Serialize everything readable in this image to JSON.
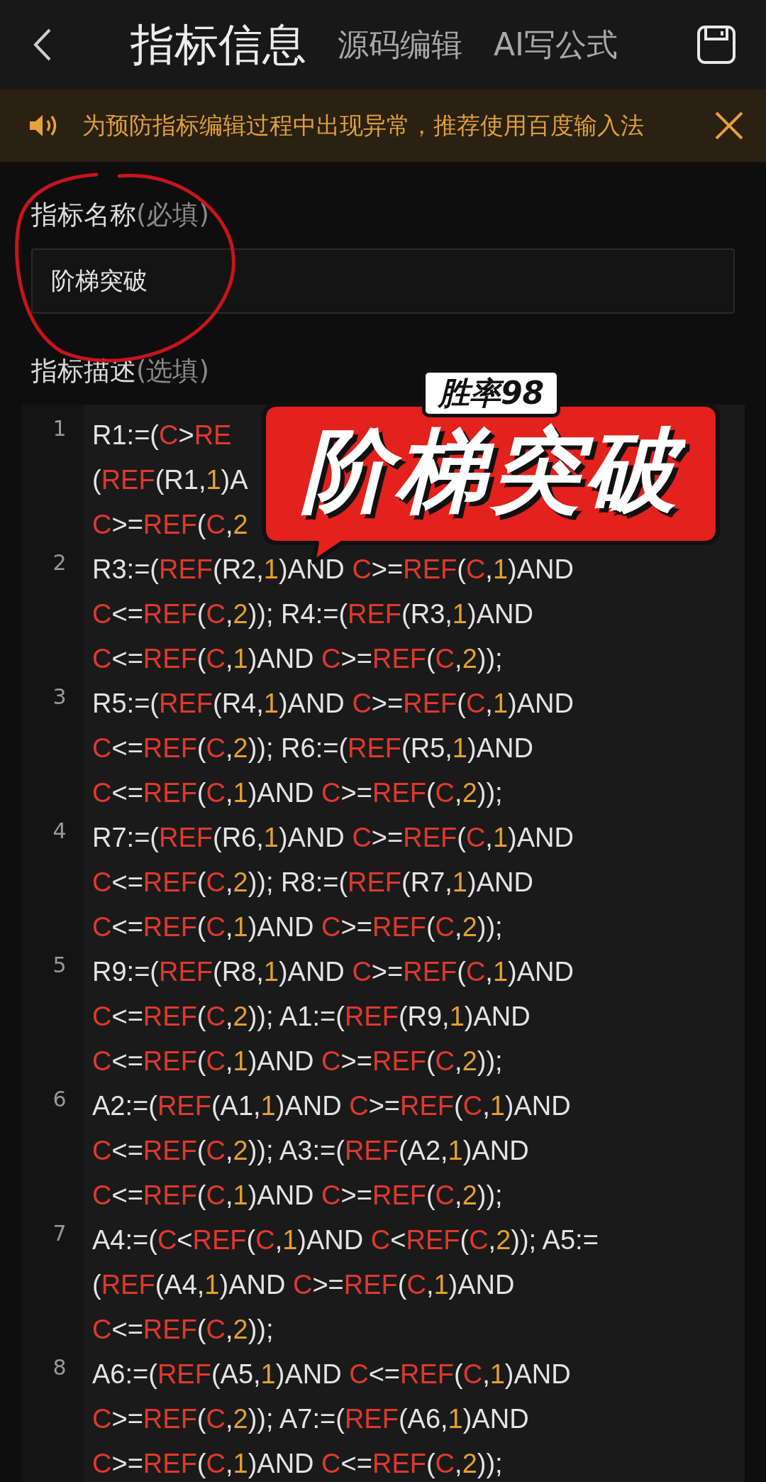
{
  "header": {
    "tabs": [
      {
        "label": "指标信息",
        "selected": true
      },
      {
        "label": "源码编辑",
        "selected": false
      },
      {
        "label": "AI写公式",
        "selected": false
      }
    ]
  },
  "notice": {
    "text": "为预防指标编辑过程中出现异常，推荐使用百度输入法"
  },
  "name_field": {
    "label": "指标名称",
    "hint": "(必填)",
    "value": "阶梯突破"
  },
  "description_field": {
    "label": "指标描述",
    "hint": "(选填)"
  },
  "code_lines": [
    {
      "number": "1",
      "rows": [
        {
          "tokens": [
            {
              "text": "R1:=(",
              "kind": "text"
            },
            {
              "text": "C",
              "kind": "func"
            },
            {
              "text": ">",
              "kind": "text"
            },
            {
              "text": "RE",
              "kind": "func"
            }
          ]
        },
        {
          "tokens": [
            {
              "text": "(",
              "kind": "text"
            },
            {
              "text": "REF",
              "kind": "func"
            },
            {
              "text": "(R1,",
              "kind": "text"
            },
            {
              "text": "1",
              "kind": "num"
            },
            {
              "text": ")A",
              "kind": "text"
            }
          ]
        },
        {
          "tokens": [
            {
              "text": "C",
              "kind": "func"
            },
            {
              "text": ">=",
              "kind": "text"
            },
            {
              "text": "REF",
              "kind": "func"
            },
            {
              "text": "(",
              "kind": "text"
            },
            {
              "text": "C",
              "kind": "func"
            },
            {
              "text": ",",
              "kind": "text"
            },
            {
              "text": "2",
              "kind": "num"
            }
          ]
        }
      ]
    },
    {
      "number": "2",
      "rows": [
        {
          "tokens": [
            {
              "text": "R3:=(",
              "kind": "text"
            },
            {
              "text": "REF",
              "kind": "func"
            },
            {
              "text": "(R2,",
              "kind": "text"
            },
            {
              "text": "1",
              "kind": "num"
            },
            {
              "text": ")AND ",
              "kind": "text"
            },
            {
              "text": "C",
              "kind": "func"
            },
            {
              "text": ">=",
              "kind": "text"
            },
            {
              "text": "REF",
              "kind": "func"
            },
            {
              "text": "(",
              "kind": "text"
            },
            {
              "text": "C",
              "kind": "func"
            },
            {
              "text": ",",
              "kind": "text"
            },
            {
              "text": "1",
              "kind": "num"
            },
            {
              "text": ")AND",
              "kind": "text"
            }
          ]
        },
        {
          "tokens": [
            {
              "text": "C",
              "kind": "func"
            },
            {
              "text": "<=",
              "kind": "text"
            },
            {
              "text": "REF",
              "kind": "func"
            },
            {
              "text": "(",
              "kind": "text"
            },
            {
              "text": "C",
              "kind": "func"
            },
            {
              "text": ",",
              "kind": "text"
            },
            {
              "text": "2",
              "kind": "num"
            },
            {
              "text": ")); R4:=(",
              "kind": "text"
            },
            {
              "text": "REF",
              "kind": "func"
            },
            {
              "text": "(R3,",
              "kind": "text"
            },
            {
              "text": "1",
              "kind": "num"
            },
            {
              "text": ")AND",
              "kind": "text"
            }
          ]
        },
        {
          "tokens": [
            {
              "text": "C",
              "kind": "func"
            },
            {
              "text": "<=",
              "kind": "text"
            },
            {
              "text": "REF",
              "kind": "func"
            },
            {
              "text": "(",
              "kind": "text"
            },
            {
              "text": "C",
              "kind": "func"
            },
            {
              "text": ",",
              "kind": "text"
            },
            {
              "text": "1",
              "kind": "num"
            },
            {
              "text": ")AND ",
              "kind": "text"
            },
            {
              "text": "C",
              "kind": "func"
            },
            {
              "text": ">=",
              "kind": "text"
            },
            {
              "text": "REF",
              "kind": "func"
            },
            {
              "text": "(",
              "kind": "text"
            },
            {
              "text": "C",
              "kind": "func"
            },
            {
              "text": ",",
              "kind": "text"
            },
            {
              "text": "2",
              "kind": "num"
            },
            {
              "text": "));",
              "kind": "text"
            }
          ]
        }
      ]
    },
    {
      "number": "3",
      "rows": [
        {
          "tokens": [
            {
              "text": "R5:=(",
              "kind": "text"
            },
            {
              "text": "REF",
              "kind": "func"
            },
            {
              "text": "(R4,",
              "kind": "text"
            },
            {
              "text": "1",
              "kind": "num"
            },
            {
              "text": ")AND ",
              "kind": "text"
            },
            {
              "text": "C",
              "kind": "func"
            },
            {
              "text": ">=",
              "kind": "text"
            },
            {
              "text": "REF",
              "kind": "func"
            },
            {
              "text": "(",
              "kind": "text"
            },
            {
              "text": "C",
              "kind": "func"
            },
            {
              "text": ",",
              "kind": "text"
            },
            {
              "text": "1",
              "kind": "num"
            },
            {
              "text": ")AND",
              "kind": "text"
            }
          ]
        },
        {
          "tokens": [
            {
              "text": "C",
              "kind": "func"
            },
            {
              "text": "<=",
              "kind": "text"
            },
            {
              "text": "REF",
              "kind": "func"
            },
            {
              "text": "(",
              "kind": "text"
            },
            {
              "text": "C",
              "kind": "func"
            },
            {
              "text": ",",
              "kind": "text"
            },
            {
              "text": "2",
              "kind": "num"
            },
            {
              "text": ")); R6:=(",
              "kind": "text"
            },
            {
              "text": "REF",
              "kind": "func"
            },
            {
              "text": "(R5,",
              "kind": "text"
            },
            {
              "text": "1",
              "kind": "num"
            },
            {
              "text": ")AND",
              "kind": "text"
            }
          ]
        },
        {
          "tokens": [
            {
              "text": "C",
              "kind": "func"
            },
            {
              "text": "<=",
              "kind": "text"
            },
            {
              "text": "REF",
              "kind": "func"
            },
            {
              "text": "(",
              "kind": "text"
            },
            {
              "text": "C",
              "kind": "func"
            },
            {
              "text": ",",
              "kind": "text"
            },
            {
              "text": "1",
              "kind": "num"
            },
            {
              "text": ")AND ",
              "kind": "text"
            },
            {
              "text": "C",
              "kind": "func"
            },
            {
              "text": ">=",
              "kind": "text"
            },
            {
              "text": "REF",
              "kind": "func"
            },
            {
              "text": "(",
              "kind": "text"
            },
            {
              "text": "C",
              "kind": "func"
            },
            {
              "text": ",",
              "kind": "text"
            },
            {
              "text": "2",
              "kind": "num"
            },
            {
              "text": "));",
              "kind": "text"
            }
          ]
        }
      ]
    },
    {
      "number": "4",
      "rows": [
        {
          "tokens": [
            {
              "text": "R7:=(",
              "kind": "text"
            },
            {
              "text": "REF",
              "kind": "func"
            },
            {
              "text": "(R6,",
              "kind": "text"
            },
            {
              "text": "1",
              "kind": "num"
            },
            {
              "text": ")AND ",
              "kind": "text"
            },
            {
              "text": "C",
              "kind": "func"
            },
            {
              "text": ">=",
              "kind": "text"
            },
            {
              "text": "REF",
              "kind": "func"
            },
            {
              "text": "(",
              "kind": "text"
            },
            {
              "text": "C",
              "kind": "func"
            },
            {
              "text": ",",
              "kind": "text"
            },
            {
              "text": "1",
              "kind": "num"
            },
            {
              "text": ")AND",
              "kind": "text"
            }
          ]
        },
        {
          "tokens": [
            {
              "text": "C",
              "kind": "func"
            },
            {
              "text": "<=",
              "kind": "text"
            },
            {
              "text": "REF",
              "kind": "func"
            },
            {
              "text": "(",
              "kind": "text"
            },
            {
              "text": "C",
              "kind": "func"
            },
            {
              "text": ",",
              "kind": "text"
            },
            {
              "text": "2",
              "kind": "num"
            },
            {
              "text": ")); R8:=(",
              "kind": "text"
            },
            {
              "text": "REF",
              "kind": "func"
            },
            {
              "text": "(R7,",
              "kind": "text"
            },
            {
              "text": "1",
              "kind": "num"
            },
            {
              "text": ")AND",
              "kind": "text"
            }
          ]
        },
        {
          "tokens": [
            {
              "text": "C",
              "kind": "func"
            },
            {
              "text": "<=",
              "kind": "text"
            },
            {
              "text": "REF",
              "kind": "func"
            },
            {
              "text": "(",
              "kind": "text"
            },
            {
              "text": "C",
              "kind": "func"
            },
            {
              "text": ",",
              "kind": "text"
            },
            {
              "text": "1",
              "kind": "num"
            },
            {
              "text": ")AND ",
              "kind": "text"
            },
            {
              "text": "C",
              "kind": "func"
            },
            {
              "text": ">=",
              "kind": "text"
            },
            {
              "text": "REF",
              "kind": "func"
            },
            {
              "text": "(",
              "kind": "text"
            },
            {
              "text": "C",
              "kind": "func"
            },
            {
              "text": ",",
              "kind": "text"
            },
            {
              "text": "2",
              "kind": "num"
            },
            {
              "text": "));",
              "kind": "text"
            }
          ]
        }
      ]
    },
    {
      "number": "5",
      "rows": [
        {
          "tokens": [
            {
              "text": "R9:=(",
              "kind": "text"
            },
            {
              "text": "REF",
              "kind": "func"
            },
            {
              "text": "(R8,",
              "kind": "text"
            },
            {
              "text": "1",
              "kind": "num"
            },
            {
              "text": ")AND ",
              "kind": "text"
            },
            {
              "text": "C",
              "kind": "func"
            },
            {
              "text": ">=",
              "kind": "text"
            },
            {
              "text": "REF",
              "kind": "func"
            },
            {
              "text": "(",
              "kind": "text"
            },
            {
              "text": "C",
              "kind": "func"
            },
            {
              "text": ",",
              "kind": "text"
            },
            {
              "text": "1",
              "kind": "num"
            },
            {
              "text": ")AND",
              "kind": "text"
            }
          ]
        },
        {
          "tokens": [
            {
              "text": "C",
              "kind": "func"
            },
            {
              "text": "<=",
              "kind": "text"
            },
            {
              "text": "REF",
              "kind": "func"
            },
            {
              "text": "(",
              "kind": "text"
            },
            {
              "text": "C",
              "kind": "func"
            },
            {
              "text": ",",
              "kind": "text"
            },
            {
              "text": "2",
              "kind": "num"
            },
            {
              "text": ")); A1:=(",
              "kind": "text"
            },
            {
              "text": "REF",
              "kind": "func"
            },
            {
              "text": "(R9,",
              "kind": "text"
            },
            {
              "text": "1",
              "kind": "num"
            },
            {
              "text": ")AND",
              "kind": "text"
            }
          ]
        },
        {
          "tokens": [
            {
              "text": "C",
              "kind": "func"
            },
            {
              "text": "<=",
              "kind": "text"
            },
            {
              "text": "REF",
              "kind": "func"
            },
            {
              "text": "(",
              "kind": "text"
            },
            {
              "text": "C",
              "kind": "func"
            },
            {
              "text": ",",
              "kind": "text"
            },
            {
              "text": "1",
              "kind": "num"
            },
            {
              "text": ")AND ",
              "kind": "text"
            },
            {
              "text": "C",
              "kind": "func"
            },
            {
              "text": ">=",
              "kind": "text"
            },
            {
              "text": "REF",
              "kind": "func"
            },
            {
              "text": "(",
              "kind": "text"
            },
            {
              "text": "C",
              "kind": "func"
            },
            {
              "text": ",",
              "kind": "text"
            },
            {
              "text": "2",
              "kind": "num"
            },
            {
              "text": "));",
              "kind": "text"
            }
          ]
        }
      ]
    },
    {
      "number": "6",
      "rows": [
        {
          "tokens": [
            {
              "text": "A2:=(",
              "kind": "text"
            },
            {
              "text": "REF",
              "kind": "func"
            },
            {
              "text": "(A1,",
              "kind": "text"
            },
            {
              "text": "1",
              "kind": "num"
            },
            {
              "text": ")AND ",
              "kind": "text"
            },
            {
              "text": "C",
              "kind": "func"
            },
            {
              "text": ">=",
              "kind": "text"
            },
            {
              "text": "REF",
              "kind": "func"
            },
            {
              "text": "(",
              "kind": "text"
            },
            {
              "text": "C",
              "kind": "func"
            },
            {
              "text": ",",
              "kind": "text"
            },
            {
              "text": "1",
              "kind": "num"
            },
            {
              "text": ")AND",
              "kind": "text"
            }
          ]
        },
        {
          "tokens": [
            {
              "text": "C",
              "kind": "func"
            },
            {
              "text": "<=",
              "kind": "text"
            },
            {
              "text": "REF",
              "kind": "func"
            },
            {
              "text": "(",
              "kind": "text"
            },
            {
              "text": "C",
              "kind": "func"
            },
            {
              "text": ",",
              "kind": "text"
            },
            {
              "text": "2",
              "kind": "num"
            },
            {
              "text": ")); A3:=(",
              "kind": "text"
            },
            {
              "text": "REF",
              "kind": "func"
            },
            {
              "text": "(A2,",
              "kind": "text"
            },
            {
              "text": "1",
              "kind": "num"
            },
            {
              "text": ")AND",
              "kind": "text"
            }
          ]
        },
        {
          "tokens": [
            {
              "text": "C",
              "kind": "func"
            },
            {
              "text": "<=",
              "kind": "text"
            },
            {
              "text": "REF",
              "kind": "func"
            },
            {
              "text": "(",
              "kind": "text"
            },
            {
              "text": "C",
              "kind": "func"
            },
            {
              "text": ",",
              "kind": "text"
            },
            {
              "text": "1",
              "kind": "num"
            },
            {
              "text": ")AND ",
              "kind": "text"
            },
            {
              "text": "C",
              "kind": "func"
            },
            {
              "text": ">=",
              "kind": "text"
            },
            {
              "text": "REF",
              "kind": "func"
            },
            {
              "text": "(",
              "kind": "text"
            },
            {
              "text": "C",
              "kind": "func"
            },
            {
              "text": ",",
              "kind": "text"
            },
            {
              "text": "2",
              "kind": "num"
            },
            {
              "text": "));",
              "kind": "text"
            }
          ]
        }
      ]
    },
    {
      "number": "7",
      "rows": [
        {
          "tokens": [
            {
              "text": "A4:=(",
              "kind": "text"
            },
            {
              "text": "C",
              "kind": "func"
            },
            {
              "text": "<",
              "kind": "text"
            },
            {
              "text": "REF",
              "kind": "func"
            },
            {
              "text": "(",
              "kind": "text"
            },
            {
              "text": "C",
              "kind": "func"
            },
            {
              "text": ",",
              "kind": "text"
            },
            {
              "text": "1",
              "kind": "num"
            },
            {
              "text": ")AND ",
              "kind": "text"
            },
            {
              "text": "C",
              "kind": "func"
            },
            {
              "text": "<",
              "kind": "text"
            },
            {
              "text": "REF",
              "kind": "func"
            },
            {
              "text": "(",
              "kind": "text"
            },
            {
              "text": "C",
              "kind": "func"
            },
            {
              "text": ",",
              "kind": "text"
            },
            {
              "text": "2",
              "kind": "num"
            },
            {
              "text": ")); A5:=",
              "kind": "text"
            }
          ]
        },
        {
          "tokens": [
            {
              "text": "(",
              "kind": "text"
            },
            {
              "text": "REF",
              "kind": "func"
            },
            {
              "text": "(A4,",
              "kind": "text"
            },
            {
              "text": "1",
              "kind": "num"
            },
            {
              "text": ")AND ",
              "kind": "text"
            },
            {
              "text": "C",
              "kind": "func"
            },
            {
              "text": ">=",
              "kind": "text"
            },
            {
              "text": "REF",
              "kind": "func"
            },
            {
              "text": "(",
              "kind": "text"
            },
            {
              "text": "C",
              "kind": "func"
            },
            {
              "text": ",",
              "kind": "text"
            },
            {
              "text": "1",
              "kind": "num"
            },
            {
              "text": ")AND",
              "kind": "text"
            }
          ]
        },
        {
          "tokens": [
            {
              "text": "C",
              "kind": "func"
            },
            {
              "text": "<=",
              "kind": "text"
            },
            {
              "text": "REF",
              "kind": "func"
            },
            {
              "text": "(",
              "kind": "text"
            },
            {
              "text": "C",
              "kind": "func"
            },
            {
              "text": ",",
              "kind": "text"
            },
            {
              "text": "2",
              "kind": "num"
            },
            {
              "text": "));",
              "kind": "text"
            }
          ]
        }
      ]
    },
    {
      "number": "8",
      "rows": [
        {
          "tokens": [
            {
              "text": "A6:=(",
              "kind": "text"
            },
            {
              "text": "REF",
              "kind": "func"
            },
            {
              "text": "(A5,",
              "kind": "text"
            },
            {
              "text": "1",
              "kind": "num"
            },
            {
              "text": ")AND ",
              "kind": "text"
            },
            {
              "text": "C",
              "kind": "func"
            },
            {
              "text": "<=",
              "kind": "text"
            },
            {
              "text": "REF",
              "kind": "func"
            },
            {
              "text": "(",
              "kind": "text"
            },
            {
              "text": "C",
              "kind": "func"
            },
            {
              "text": ",",
              "kind": "text"
            },
            {
              "text": "1",
              "kind": "num"
            },
            {
              "text": ")AND",
              "kind": "text"
            }
          ]
        },
        {
          "tokens": [
            {
              "text": "C",
              "kind": "func"
            },
            {
              "text": ">=",
              "kind": "text"
            },
            {
              "text": "REF",
              "kind": "func"
            },
            {
              "text": "(",
              "kind": "text"
            },
            {
              "text": "C",
              "kind": "func"
            },
            {
              "text": ",",
              "kind": "text"
            },
            {
              "text": "2",
              "kind": "num"
            },
            {
              "text": ")); A7:=(",
              "kind": "text"
            },
            {
              "text": "REF",
              "kind": "func"
            },
            {
              "text": "(A6,",
              "kind": "text"
            },
            {
              "text": "1",
              "kind": "num"
            },
            {
              "text": ")AND",
              "kind": "text"
            }
          ]
        },
        {
          "tokens": [
            {
              "text": "C",
              "kind": "func"
            },
            {
              "text": ">=",
              "kind": "text"
            },
            {
              "text": "REF",
              "kind": "func"
            },
            {
              "text": "(",
              "kind": "text"
            },
            {
              "text": "C",
              "kind": "func"
            },
            {
              "text": ",",
              "kind": "text"
            },
            {
              "text": "1",
              "kind": "num"
            },
            {
              "text": ")AND ",
              "kind": "text"
            },
            {
              "text": "C",
              "kind": "func"
            },
            {
              "text": "<=",
              "kind": "text"
            },
            {
              "text": "REF",
              "kind": "func"
            },
            {
              "text": "(",
              "kind": "text"
            },
            {
              "text": "C",
              "kind": "func"
            },
            {
              "text": ",",
              "kind": "text"
            },
            {
              "text": "2",
              "kind": "num"
            },
            {
              "text": "));",
              "kind": "text"
            }
          ]
        }
      ]
    }
  ],
  "sticker": {
    "tag": "胜率98",
    "title": "阶梯突破"
  }
}
